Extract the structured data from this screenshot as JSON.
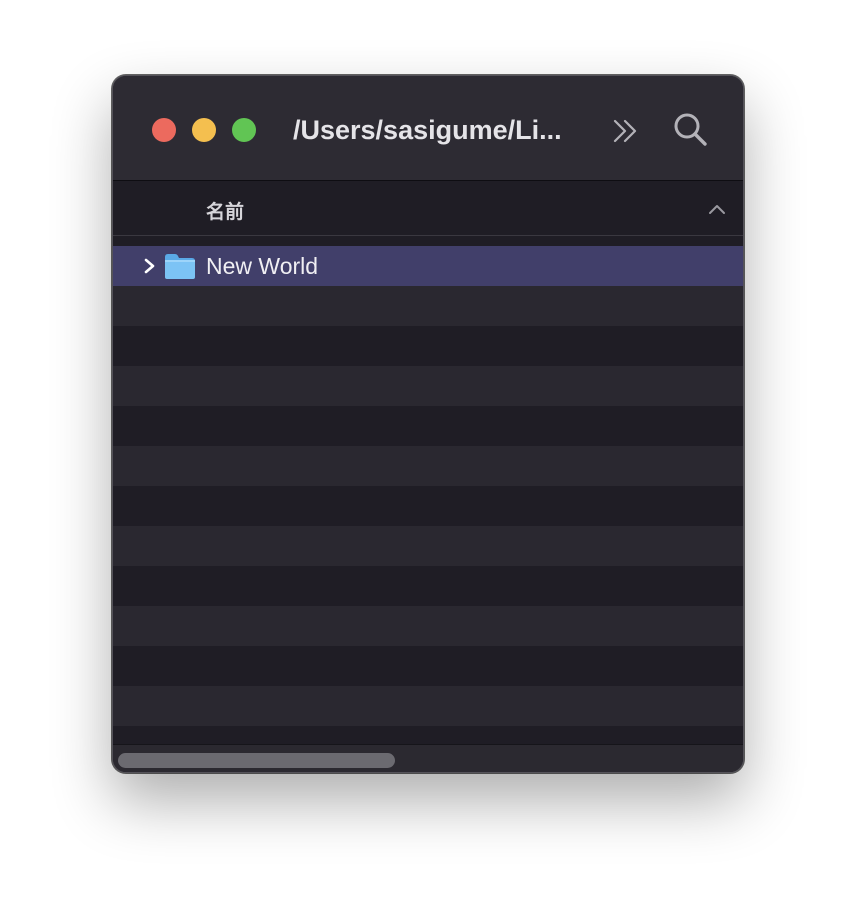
{
  "window": {
    "title": "/Users/sasigume/Li...",
    "traffic_lights": {
      "close_color": "#ec6a5e",
      "minimize_color": "#f4bf4f",
      "zoom_color": "#61c554"
    },
    "toolbar": {
      "overflow_icon": "double-chevron-right-icon",
      "search_icon": "magnifying-glass-icon"
    }
  },
  "list": {
    "column_header": "名前",
    "sort_indicator": "chevron-up-icon",
    "items": [
      {
        "label": "New World",
        "icon": "folder-icon",
        "expandable": true,
        "selected": true
      }
    ],
    "selection_color": "#413f6a"
  }
}
